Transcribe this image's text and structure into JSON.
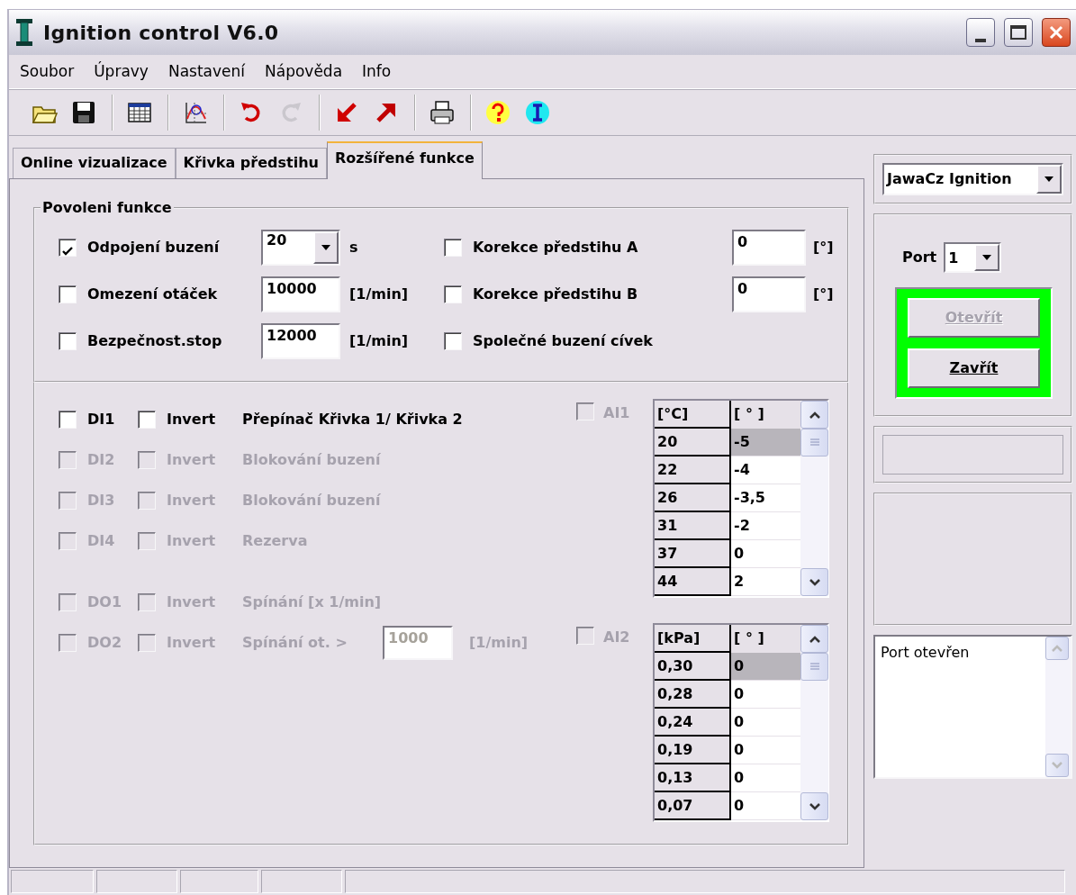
{
  "window": {
    "title": "Ignition control V6.0"
  },
  "menu": [
    {
      "label": "Soubor"
    },
    {
      "label": "Úpravy"
    },
    {
      "label": "Nastavení"
    },
    {
      "label": "Nápověda"
    },
    {
      "label": "Info"
    }
  ],
  "toolbar": {
    "groups": [
      {
        "items": [
          {
            "kind": "open",
            "disabled": false
          },
          {
            "kind": "save",
            "disabled": false
          }
        ]
      },
      {
        "items": [
          {
            "kind": "table",
            "disabled": false
          }
        ]
      },
      {
        "items": [
          {
            "kind": "chart",
            "disabled": false
          }
        ]
      },
      {
        "items": [
          {
            "kind": "undo",
            "disabled": false
          },
          {
            "kind": "redo",
            "disabled": true
          }
        ]
      },
      {
        "items": [
          {
            "kind": "import",
            "disabled": false
          },
          {
            "kind": "export",
            "disabled": false
          }
        ]
      },
      {
        "items": [
          {
            "kind": "print",
            "disabled": false
          }
        ]
      },
      {
        "items": [
          {
            "kind": "help",
            "disabled": false
          },
          {
            "kind": "info",
            "disabled": false
          }
        ]
      }
    ]
  },
  "tabs": [
    {
      "label": "Online vizualizace",
      "selected": false
    },
    {
      "label": "Křivka předstihu",
      "selected": false
    },
    {
      "label": "Rozšířené funkce",
      "selected": true
    }
  ],
  "enable_group": {
    "title": "Povoleni funkce",
    "left": [
      {
        "label": "Odpojení buzení",
        "checked": true,
        "kind": "combo",
        "value": "20",
        "unit": "s"
      },
      {
        "label": "Omezení otáček",
        "checked": false,
        "kind": "input",
        "value": "10000",
        "unit": "[1/min]"
      },
      {
        "label": "Bezpečnost.stop",
        "checked": false,
        "kind": "input",
        "value": "12000",
        "unit": "[1/min]"
      }
    ],
    "right": [
      {
        "label": "Korekce předstihu A",
        "checked": false,
        "kind": "input",
        "value": "0",
        "unit": "[°]"
      },
      {
        "label": "Korekce předstihu B",
        "checked": false,
        "kind": "input",
        "value": "0",
        "unit": "[°]"
      },
      {
        "label": "Společné buzení cívek",
        "checked": false,
        "kind": "plain"
      }
    ]
  },
  "io_groups": [
    {
      "rows": [
        {
          "label": "DI1",
          "checked": false,
          "disabled": false,
          "invert": {
            "label": "Invert",
            "checked": false
          },
          "description": "Přepínač Křivka 1/ Křivka 2"
        },
        {
          "label": "DI2",
          "checked": false,
          "disabled": true,
          "invert": {
            "label": "Invert",
            "checked": false
          },
          "description": "Blokování buzení"
        },
        {
          "label": "DI3",
          "checked": false,
          "disabled": true,
          "invert": {
            "label": "Invert",
            "checked": false
          },
          "description": "Blokování buzení"
        },
        {
          "label": "DI4",
          "checked": false,
          "disabled": true,
          "invert": {
            "label": "Invert",
            "checked": false
          },
          "description": "Rezerva"
        }
      ]
    },
    {
      "rows": [
        {
          "label": "DO1",
          "checked": false,
          "disabled": true,
          "invert": {
            "label": "Invert",
            "checked": false
          },
          "description": "Spínání [x 1/min]"
        },
        {
          "label": "DO2",
          "checked": false,
          "disabled": true,
          "invert": {
            "label": "Invert",
            "checked": false
          },
          "description": "Spínání ot. >",
          "value": "1000",
          "unit": "[1/min]"
        }
      ]
    }
  ],
  "analog": [
    {
      "label": "AI1",
      "checked": false,
      "disabled": true,
      "columns": [
        "[°C]",
        "[ ° ]"
      ],
      "rows": [
        {
          "key": "20",
          "value": "-5",
          "selected": true
        },
        {
          "key": "22",
          "value": "-4",
          "selected": false
        },
        {
          "key": "26",
          "value": "-3,5",
          "selected": false
        },
        {
          "key": "31",
          "value": "-2",
          "selected": false
        },
        {
          "key": "37",
          "value": "0",
          "selected": false
        },
        {
          "key": "44",
          "value": "2",
          "selected": false
        }
      ]
    },
    {
      "label": "AI2",
      "checked": false,
      "disabled": true,
      "columns": [
        "[kPa]",
        "[ ° ]"
      ],
      "rows": [
        {
          "key": "0,30",
          "value": "0",
          "selected": true
        },
        {
          "key": "0,28",
          "value": "0",
          "selected": false
        },
        {
          "key": "0,24",
          "value": "0",
          "selected": false
        },
        {
          "key": "0,19",
          "value": "0",
          "selected": false
        },
        {
          "key": "0,13",
          "value": "0",
          "selected": false
        },
        {
          "key": "0,07",
          "value": "0",
          "selected": false
        }
      ]
    }
  ],
  "sidebar": {
    "device": "JawaCz Ignition",
    "port_label": "Port",
    "port": "1",
    "buttons": [
      {
        "label": "Otevřít",
        "disabled": true
      },
      {
        "label": "Zavřít",
        "disabled": false
      }
    ],
    "log": "Port otevřen"
  }
}
